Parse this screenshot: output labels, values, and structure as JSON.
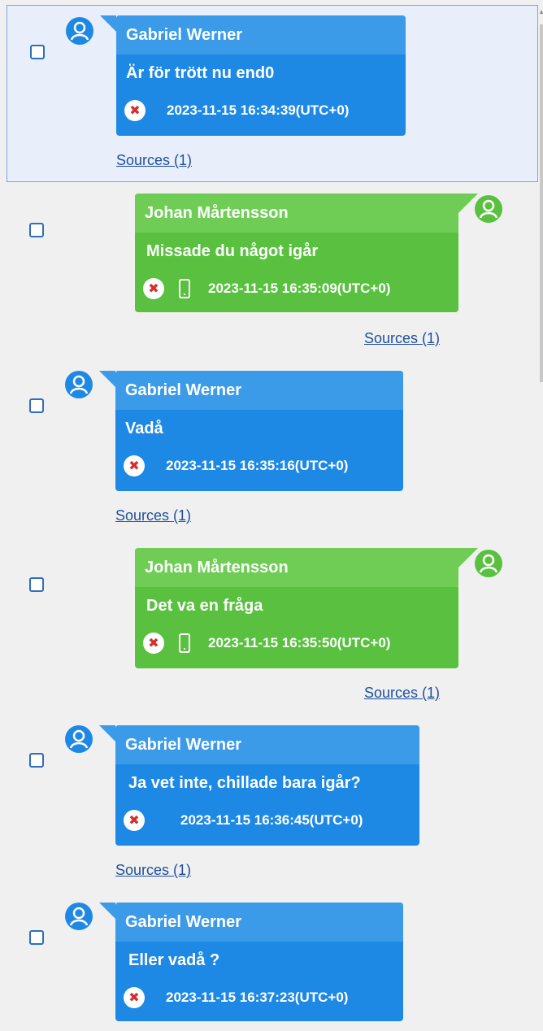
{
  "colors": {
    "blue_header": "#3b9be9",
    "blue_body": "#1e88e5",
    "green_header": "#6fcd56",
    "green_body": "#59c13f",
    "selection_bg": "#e8eefa",
    "link": "#1f4f9d"
  },
  "messages": [
    {
      "sender": "Gabriel Werner",
      "text": "Är för trött nu end0",
      "timestamp": "2023-11-15 16:34:39(UTC+0)",
      "sources": "Sources (1)",
      "direction": "incoming",
      "selected": true,
      "status_icon": "error-icon"
    },
    {
      "sender": "Johan Mårtensson",
      "text": "Missade du något igår",
      "timestamp": "2023-11-15 16:35:09(UTC+0)",
      "sources": "Sources (1)",
      "direction": "outgoing",
      "selected": false,
      "status_icon": "error-icon",
      "device_icon": "phone-icon"
    },
    {
      "sender": "Gabriel Werner",
      "text": "Vadå",
      "timestamp": "2023-11-15 16:35:16(UTC+0)",
      "sources": "Sources (1)",
      "direction": "incoming",
      "selected": false,
      "status_icon": "error-icon"
    },
    {
      "sender": "Johan Mårtensson",
      "text": "Det va en fråga",
      "timestamp": "2023-11-15 16:35:50(UTC+0)",
      "sources": "Sources (1)",
      "direction": "outgoing",
      "selected": false,
      "status_icon": "error-icon",
      "device_icon": "phone-icon"
    },
    {
      "sender": "Gabriel Werner",
      "text": "Ja vet inte, chillade bara igår?",
      "timestamp": "2023-11-15 16:36:45(UTC+0)",
      "sources": "Sources (1)",
      "direction": "incoming",
      "selected": false,
      "status_icon": "error-icon"
    },
    {
      "sender": "Gabriel Werner",
      "text": "Eller vadå ?",
      "timestamp": "2023-11-15 16:37:23(UTC+0)",
      "sources": "",
      "direction": "incoming",
      "selected": false,
      "status_icon": "error-icon"
    }
  ]
}
